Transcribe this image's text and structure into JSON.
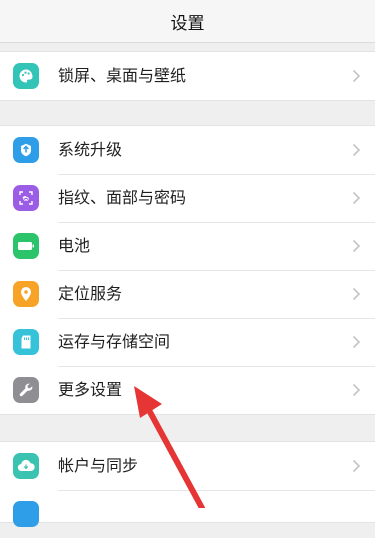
{
  "header": {
    "title": "设置"
  },
  "groups": [
    {
      "items": [
        {
          "label": "锁屏、桌面与壁纸",
          "icon": "palette-icon",
          "color": "#33c4b8"
        }
      ]
    },
    {
      "items": [
        {
          "label": "系统升级",
          "icon": "system-update-icon",
          "color": "#2f9ee8"
        },
        {
          "label": "指纹、面部与密码",
          "icon": "fingerprint-face-icon",
          "color": "#9b5de5"
        },
        {
          "label": "电池",
          "icon": "battery-icon",
          "color": "#2cc46b"
        },
        {
          "label": "定位服务",
          "icon": "location-pin-icon",
          "color": "#f7a327"
        },
        {
          "label": "运存与存储空间",
          "icon": "storage-card-icon",
          "color": "#36c2d8"
        },
        {
          "label": "更多设置",
          "icon": "wrench-icon",
          "color": "#8e8e93"
        }
      ]
    },
    {
      "items": [
        {
          "label": "帐户与同步",
          "icon": "cloud-sync-icon",
          "color": "#3ac3b0"
        }
      ]
    }
  ],
  "annotation": {
    "arrow_color": "#e53535"
  }
}
